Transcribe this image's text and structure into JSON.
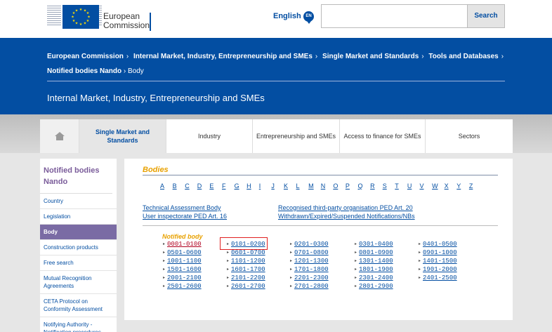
{
  "header": {
    "logo_text": "European Commission",
    "language": "English",
    "language_code": "EN",
    "search_placeholder": "",
    "search_button": "Search"
  },
  "breadcrumb": {
    "items": [
      "European Commission",
      "Internal Market, Industry, Entrepreneurship and SMEs",
      "Single Market and Standards",
      "Tools and Databases"
    ],
    "row2_bold": "Notified bodies Nando",
    "row2_last": "Body"
  },
  "banner": {
    "title": "Internal Market, Industry, Entrepreneurship and SMEs"
  },
  "tabs": {
    "home_icon": "home-icon",
    "items": [
      "Single Market and Standards",
      "Industry",
      "Entrepreneurship and SMEs",
      "Access to finance for SMEs",
      "Sectors"
    ]
  },
  "sidenav": {
    "heading": "Notified bodies Nando",
    "items": [
      "Country",
      "Legislation",
      "Body",
      "Construction products",
      "Free search",
      "Mutual Recognition Agreements",
      "CETA Protocol on Conformity Assessment",
      "Notifying Authority - Notification procedures"
    ],
    "active_index": 2
  },
  "main": {
    "title": "Bodies",
    "letters": [
      "A",
      "B",
      "C",
      "D",
      "E",
      "F",
      "G",
      "H",
      "I",
      "J",
      "K",
      "L",
      "M",
      "N",
      "O",
      "P",
      "Q",
      "R",
      "S",
      "T",
      "U",
      "V",
      "W",
      "X",
      "Y",
      "Z"
    ],
    "links_left": [
      "Technical Assessment Body",
      "User inspectorate PED Art. 16"
    ],
    "links_right": [
      "Recognised third-party organisation PED Art. 20",
      "Withdrawn/Expired/Suspended Notifications/NBs"
    ],
    "notified_title": "Notified body",
    "ranges": [
      [
        "0001-0100",
        "0501-0600",
        "1001-1100",
        "1501-1600",
        "2001-2100",
        "2501-2600"
      ],
      [
        "0101-0200",
        "0601-0700",
        "1101-1200",
        "1601-1700",
        "2101-2200",
        "2601-2700"
      ],
      [
        "0201-0300",
        "0701-0800",
        "1201-1300",
        "1701-1800",
        "2201-2300",
        "2701-2800"
      ],
      [
        "0301-0400",
        "0801-0900",
        "1301-1400",
        "1801-1900",
        "2301-2400",
        "2801-2900"
      ],
      [
        "0401-0500",
        "0901-1000",
        "1401-1500",
        "1901-2000",
        "2401-2500"
      ]
    ]
  },
  "colors": {
    "brand_blue": "#034ea2",
    "accent_orange": "#e8a100",
    "nav_active": "#7a6ba4",
    "highlight_box": "#e02020"
  }
}
